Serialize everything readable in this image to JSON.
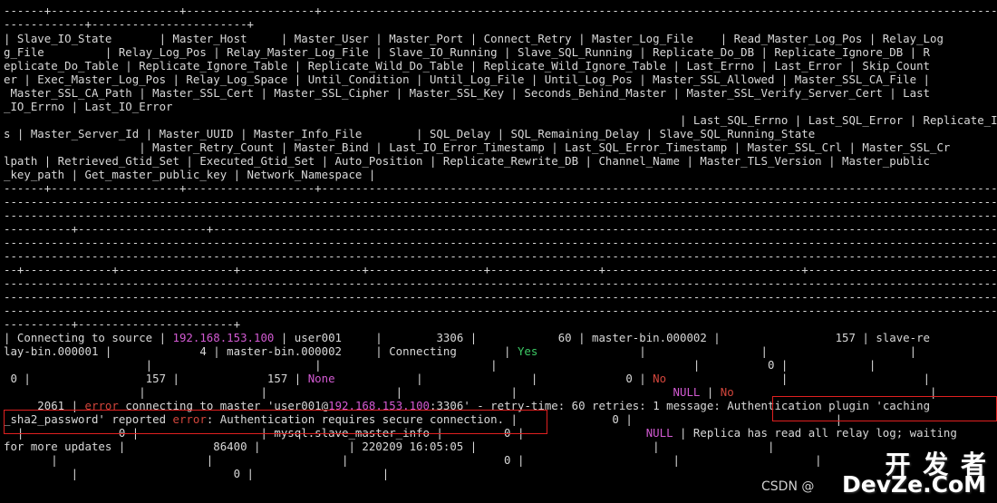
{
  "colors": {
    "background": "#000000",
    "text": "#d8d8d8",
    "ip_highlight": "#d25ad2",
    "error_highlight": "#d2463c",
    "yes_highlight": "#3cc864",
    "annotation_box": "#e02020"
  },
  "header_lines": [
    "------+-------------------+-------------------+----------------------------------------------------------------------------------------------------",
    "------------+-----------------------+",
    "| Slave_IO_State       | Master_Host     | Master_User | Master_Port | Connect_Retry | Master_Log_File    | Read_Master_Log_Pos | Relay_Log",
    "g_File         | Relay_Log_Pos | Relay_Master_Log_File | Slave_IO_Running | Slave_SQL_Running | Replicate_Do_DB | Replicate_Ignore_DB | R",
    "eplicate_Do_Table | Replicate_Ignore_Table | Replicate_Wild_Do_Table | Replicate_Wild_Ignore_Table | Last_Errno | Last_Error | Skip_Count",
    "er | Exec_Master_Log_Pos | Relay_Log_Space | Until_Condition | Until_Log_File | Until_Log_Pos | Master_SSL_Allowed | Master_SSL_CA_File |",
    " Master_SSL_CA_Path | Master_SSL_Cert | Master_SSL_Cipher | Master_SSL_Key | Seconds_Behind_Master | Master_SSL_Verify_Server_Cert | Last",
    "_IO_Errno | Last_IO_Error",
    "                                                                                                    | Last_SQL_Errno | Last_SQL_Error | Replicate_Ignore_Server_Id",
    "s | Master_Server_Id | Master_UUID | Master_Info_File        | SQL_Delay | SQL_Remaining_Delay | Slave_SQL_Running_State",
    "                    | Master_Retry_Count | Master_Bind | Last_IO_Error_Timestamp | Last_SQL_Error_Timestamp | Master_SSL_Crl | Master_SSL_Cr",
    "lpath | Retrieved_Gtid_Set | Executed_Gtid_Set | Auto_Position | Replicate_Rewrite_DB | Channel_Name | Master_TLS_Version | Master_public",
    "_key_path | Get_master_public_key | Network_Namespace |",
    "------+-------------------+-------------------+-----------------------------------------------------------------------------------------------------"
  ],
  "separator_lines": [
    "-----------------------------------------------------------------------------------------------------------------------------------------------------",
    "-----------------------------------------------------------------------------------------------------------------------------------------------------",
    "----------+-------------------+-------------------------------------------------------------------------------------------------------------------------",
    "-----------------------------------------------------------------------------------------------------------------------------------------------------",
    "-----------------------------------------------------------------------------------------------------------------------------------------------------",
    "--+-------------+-----------------+------------------+-----------------+----------------+-----------------------------+------------------------------",
    "-----------------------------------------------------------------------------------------------------------------------------------------------------",
    "-----------------------------------------------------------------------------------------------------------------------------------------------------",
    "-----------------------------------------------------------------------------------------------------------------------------------------------------",
    "----------+-----------------------+"
  ],
  "row": {
    "line1_a": "| Connecting to source | ",
    "line1_ip": "192.168.153.100",
    "line1_b": " | user001     |        3306 |            60 | master-bin.000002 |                 157 | slave-re",
    "line2_a": "lay-bin.000001 |             4 | master-bin.000002     | Connecting       | ",
    "line2_yes": "Yes",
    "line2_b": "               |                 |                     |",
    "line3": "                     |                        |                         |                             |          0 |            |",
    "line4_a": " 0 |                 157 |             157 | ",
    "line4_none": "None",
    "line4_b": "            |                |             0 | ",
    "line4_no": "No",
    "line4_c": "                 |                    |",
    "line5_a": "                    |                 |                   |                |                       ",
    "line5_null": "NULL",
    "line5_sep": " | ",
    "line5_no": "No",
    "line5_b": "                             |",
    "line6_a": "     2061 | ",
    "line6_error1": "error",
    "line6_b": " connecting to master 'user001@",
    "line6_ip": "192.168.153.100",
    "line6_c": ":3306' - retry-time: 60 retries: 1 message: Authentication plugin 'caching",
    "line7_a": "_sha2_password' reported ",
    "line7_error2": "error",
    "line7_b": ": Authentication requires secure connection. |              0 |                              |",
    "line8_a": "  |              0 |                  | mysql.slave_master_info |         0 |                  ",
    "line8_null": "NULL",
    "line8_b": " | Replica has read all relay log; waiting",
    "line9": "for more updates |             86400 |             | 220209 16:05:05 |                          |                |",
    "line10": "       |                      |                   |                       0 |                      |                    |",
    "line11": "          |                       0 |                   |"
  },
  "watermark": {
    "main": "开 发 者",
    "sub": "DevZe.CoM",
    "csdn": "CSDN @"
  }
}
